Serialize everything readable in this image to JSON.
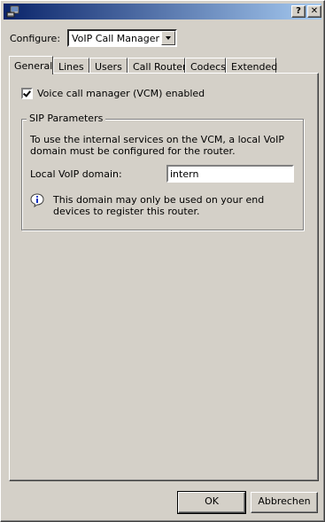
{
  "window": {
    "icon": "phone-network-icon",
    "help_label": "?",
    "close_label": "✕"
  },
  "configure": {
    "label": "Configure:",
    "selected": "VoIP Call Manager"
  },
  "tabs": [
    {
      "label": "General",
      "active": true
    },
    {
      "label": "Lines"
    },
    {
      "label": "Users"
    },
    {
      "label": "Call Router"
    },
    {
      "label": "Codecs"
    },
    {
      "label": "Extended"
    }
  ],
  "general": {
    "vcm_checkbox_label": "Voice call manager (VCM) enabled",
    "vcm_checked": true,
    "sip": {
      "title": "SIP Parameters",
      "description": "To use the internal services on the VCM, a local VoIP domain must be configured for the router.",
      "domain_label": "Local VoIP domain:",
      "domain_value": "intern",
      "info_text": "This domain may only be used on your end devices to register this router."
    }
  },
  "buttons": {
    "ok": "OK",
    "cancel": "Abbrechen"
  }
}
